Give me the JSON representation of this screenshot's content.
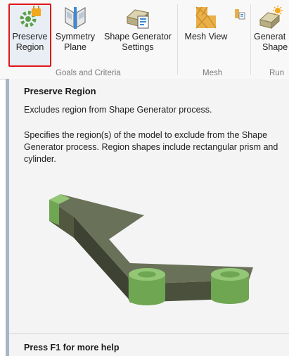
{
  "ribbon": {
    "tools": [
      {
        "id": "preserve-region",
        "line1": "Preserve",
        "line2": "Region"
      },
      {
        "id": "symmetry-plane",
        "line1": "Symmetry",
        "line2": "Plane"
      },
      {
        "id": "shape-generator-settings",
        "line1": "Shape Generator",
        "line2": "Settings"
      },
      {
        "id": "mesh-view",
        "line1": "Mesh View",
        "line2": ""
      },
      {
        "id": "generate-shape",
        "line1": "Generat",
        "line2": "Shape"
      }
    ],
    "groups": {
      "goals": "Goals and Criteria",
      "mesh": "Mesh",
      "run": "Run"
    }
  },
  "tooltip": {
    "title": "Preserve Region",
    "short_description": "Excludes region from Shape Generator process.",
    "long_description": "Specifies the region(s) of the model to exclude from the Shape Generator process. Region shapes include rectangular prism and cylinder.",
    "help": "Press F1 for more help"
  },
  "colors": {
    "highlight_border": "#e0151b",
    "model_body": "#5f6651",
    "model_region": "#7fb563"
  }
}
